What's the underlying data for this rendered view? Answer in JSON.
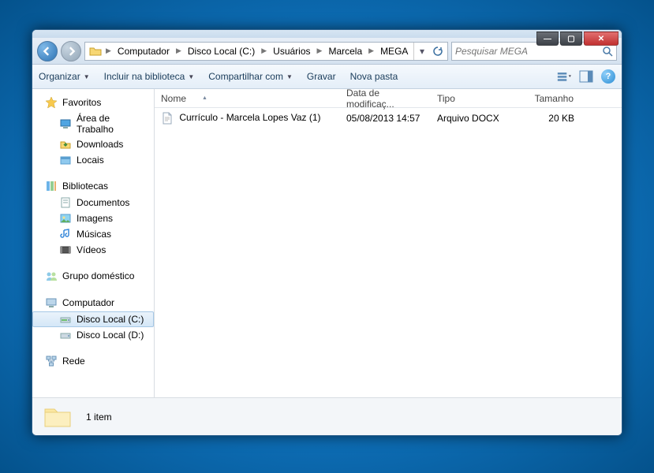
{
  "window_controls": {
    "min": "—",
    "max": "▢",
    "close": "✕"
  },
  "breadcrumb": {
    "segments": [
      "Computador",
      "Disco Local (C:)",
      "Usuários",
      "Marcela",
      "MEGA"
    ]
  },
  "search": {
    "placeholder": "Pesquisar MEGA"
  },
  "toolbar": {
    "organize": "Organizar",
    "include": "Incluir na biblioteca",
    "share": "Compartilhar com",
    "burn": "Gravar",
    "newfolder": "Nova pasta"
  },
  "sidebar": {
    "favorites": {
      "label": "Favoritos",
      "items": [
        {
          "icon": "desktop",
          "label": "Área de Trabalho"
        },
        {
          "icon": "download",
          "label": "Downloads"
        },
        {
          "icon": "places",
          "label": "Locais"
        }
      ]
    },
    "libraries": {
      "label": "Bibliotecas",
      "items": [
        {
          "icon": "doc",
          "label": "Documentos"
        },
        {
          "icon": "image",
          "label": "Imagens"
        },
        {
          "icon": "music",
          "label": "Músicas"
        },
        {
          "icon": "video",
          "label": "Vídeos"
        }
      ]
    },
    "homegroup": {
      "label": "Grupo doméstico"
    },
    "computer": {
      "label": "Computador",
      "items": [
        {
          "icon": "drive",
          "label": "Disco Local (C:)",
          "selected": true
        },
        {
          "icon": "drive",
          "label": "Disco Local (D:)"
        }
      ]
    },
    "network": {
      "label": "Rede"
    }
  },
  "columns": {
    "name": "Nome",
    "modified": "Data de modificaç...",
    "type": "Tipo",
    "size": "Tamanho"
  },
  "files": [
    {
      "name": "Currículo - Marcela Lopes Vaz (1)",
      "modified": "05/08/2013 14:57",
      "type": "Arquivo DOCX",
      "size": "20 KB"
    }
  ],
  "statusbar": {
    "count": "1 item"
  }
}
